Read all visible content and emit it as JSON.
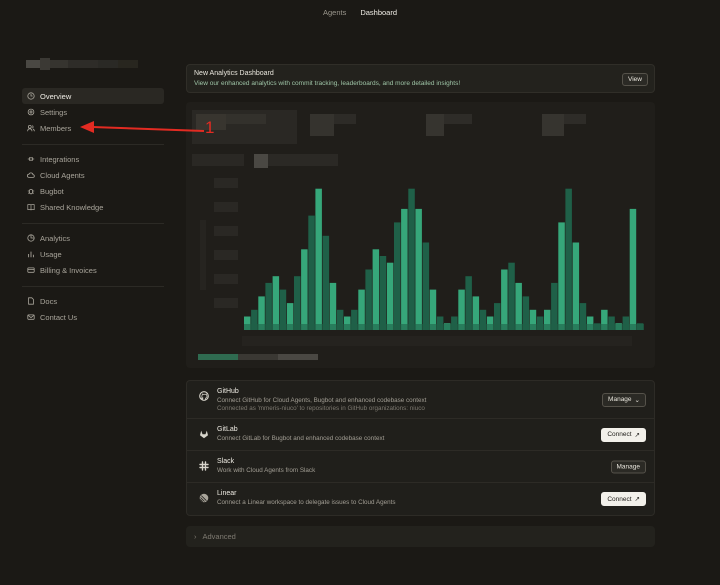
{
  "topnav": {
    "tabs": [
      {
        "label": "Agents"
      },
      {
        "label": "Dashboard"
      }
    ]
  },
  "sidebar": {
    "groups": [
      {
        "items": [
          {
            "label": "Overview",
            "icon": "clock-icon"
          },
          {
            "label": "Settings",
            "icon": "gear-icon"
          },
          {
            "label": "Members",
            "icon": "users-icon"
          }
        ]
      },
      {
        "items": [
          {
            "label": "Integrations",
            "icon": "plug-icon"
          },
          {
            "label": "Cloud Agents",
            "icon": "cloud-icon"
          },
          {
            "label": "Bugbot",
            "icon": "bug-icon"
          },
          {
            "label": "Shared Knowledge",
            "icon": "book-icon"
          }
        ]
      },
      {
        "items": [
          {
            "label": "Analytics",
            "icon": "pie-icon"
          },
          {
            "label": "Usage",
            "icon": "bar-chart-icon"
          },
          {
            "label": "Billing & Invoices",
            "icon": "credit-card-icon"
          }
        ]
      },
      {
        "items": [
          {
            "label": "Docs",
            "icon": "document-icon"
          },
          {
            "label": "Contact Us",
            "icon": "mail-icon"
          }
        ]
      }
    ]
  },
  "banner": {
    "title": "New Analytics Dashboard",
    "subtitle": "View our enhanced analytics with commit tracking, leaderboards, and more detailed insights!",
    "button": "View"
  },
  "integrations": [
    {
      "name": "GitHub",
      "icon": "github-icon",
      "desc": "Connect GitHub for Cloud Agents, Bugbot and enhanced codebase context",
      "sub": "Connected as 'mmeris-niuco' to repositories in GitHub organizations: niuco",
      "button": "Manage",
      "button_icon": "⌄",
      "button_style": "dark"
    },
    {
      "name": "GitLab",
      "icon": "gitlab-icon",
      "desc": "Connect GitLab for Bugbot and enhanced codebase context",
      "sub": "",
      "button": "Connect",
      "button_icon": "↗",
      "button_style": "light"
    },
    {
      "name": "Slack",
      "icon": "slack-icon",
      "desc": "Work with Cloud Agents from Slack",
      "sub": "",
      "button": "Manage",
      "button_icon": "",
      "button_style": "dark"
    },
    {
      "name": "Linear",
      "icon": "linear-icon",
      "desc": "Connect a Linear workspace to delegate issues to Cloud Agents",
      "sub": "",
      "button": "Connect",
      "button_icon": "↗",
      "button_style": "light"
    }
  ],
  "advanced": {
    "label": "Advanced"
  },
  "annotation": {
    "label": "1",
    "color": "#e32b22"
  },
  "chart_data": {
    "type": "bar",
    "values": [
      2,
      3,
      5,
      7,
      8,
      6,
      4,
      8,
      12,
      17,
      21,
      14,
      7,
      3,
      2,
      3,
      6,
      9,
      12,
      11,
      10,
      16,
      18,
      21,
      18,
      13,
      6,
      2,
      1,
      2,
      6,
      8,
      5,
      3,
      2,
      4,
      9,
      10,
      7,
      5,
      3,
      2,
      3,
      7,
      16,
      21,
      13,
      4,
      2,
      1,
      3,
      2,
      1,
      2,
      18,
      1
    ],
    "ylim": [
      0,
      22
    ],
    "colors": {
      "bar_light": "#36a77a",
      "bar_dark": "#1f6048"
    }
  }
}
